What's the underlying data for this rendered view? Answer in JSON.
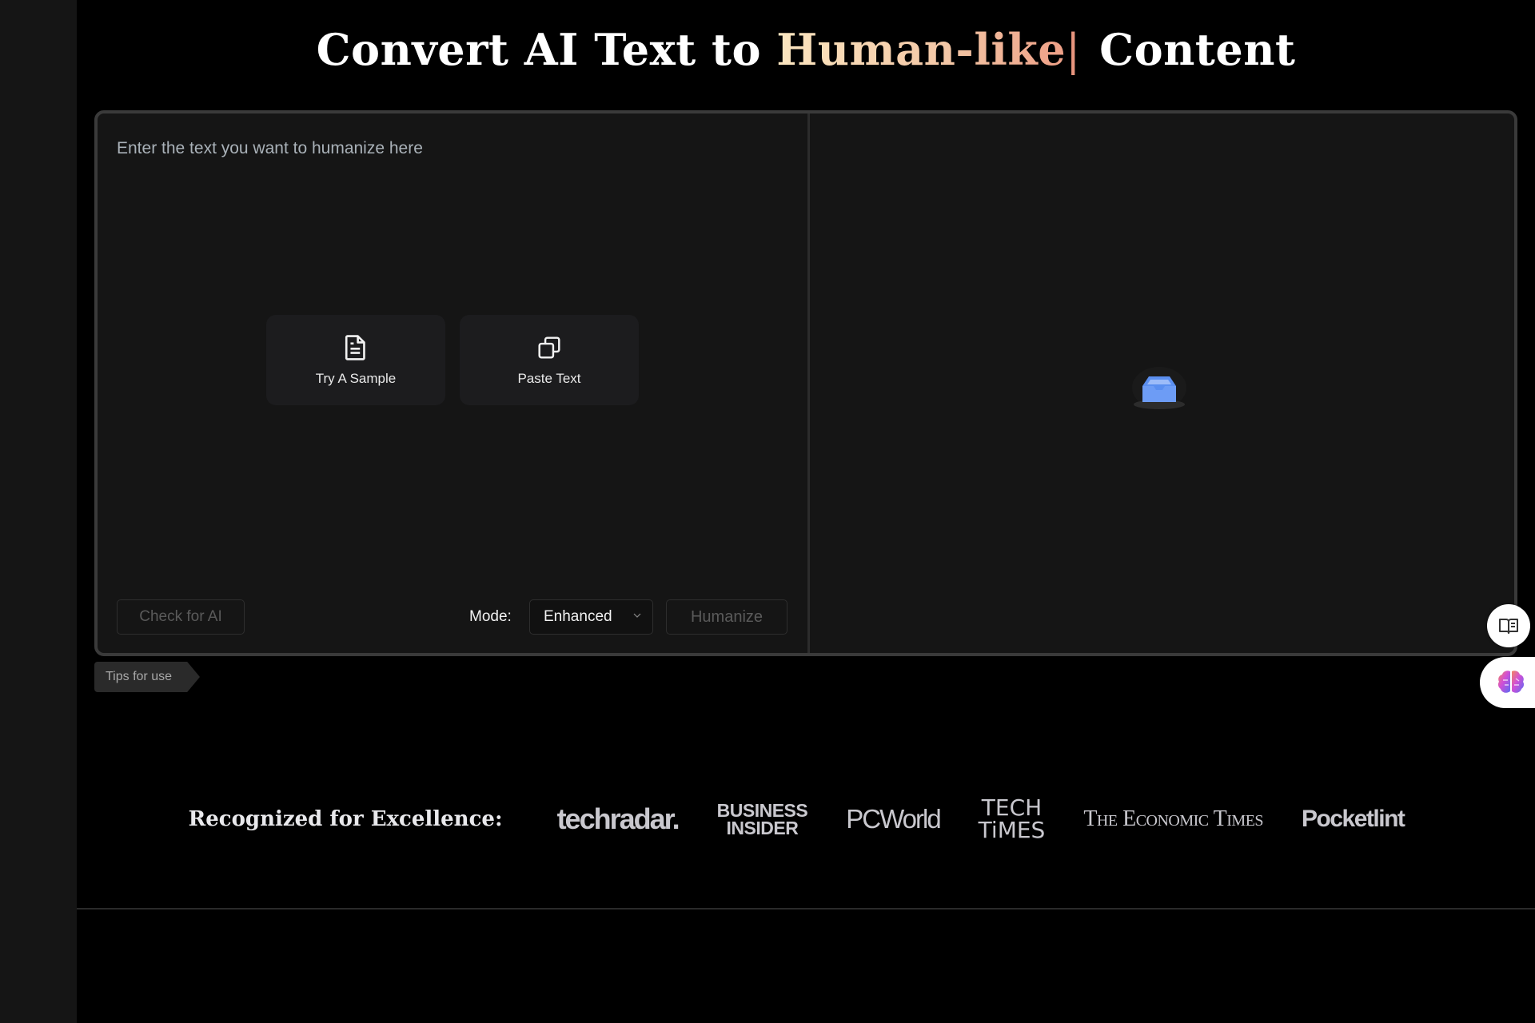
{
  "header": {
    "title_prefix": "Convert AI Text to ",
    "title_highlight": "Human-like",
    "title_caret": "|",
    "title_suffix": " Content",
    "highlight_gradient": [
      "#fbe6c0",
      "#ee9f86"
    ]
  },
  "editor": {
    "input_placeholder": "Enter the text you want to humanize here",
    "try_sample_label": "Try A Sample",
    "try_sample_icon": "document-icon",
    "paste_text_label": "Paste Text",
    "paste_text_icon": "copy-icon",
    "check_ai_label": "Check for AI",
    "mode_label": "Mode:",
    "mode_selected": "Enhanced",
    "humanize_label": "Humanize",
    "output_empty_icon": "inbox-icon"
  },
  "tips": {
    "label": "Tips for use"
  },
  "floating": {
    "guide_icon": "book-icon",
    "ai_icon": "brain-icon"
  },
  "recognition": {
    "label": "Recognized for Excellence:",
    "logos": {
      "techradar": "techradar.",
      "business_insider_line1": "BUSINESS",
      "business_insider_line2": "INSIDER",
      "pcworld": "PCWorld",
      "techtimes_line1": "TECH",
      "techtimes_line2": "TiMES",
      "economic_times": "The Economic Times",
      "pocketlint": "Pocketlint"
    }
  }
}
